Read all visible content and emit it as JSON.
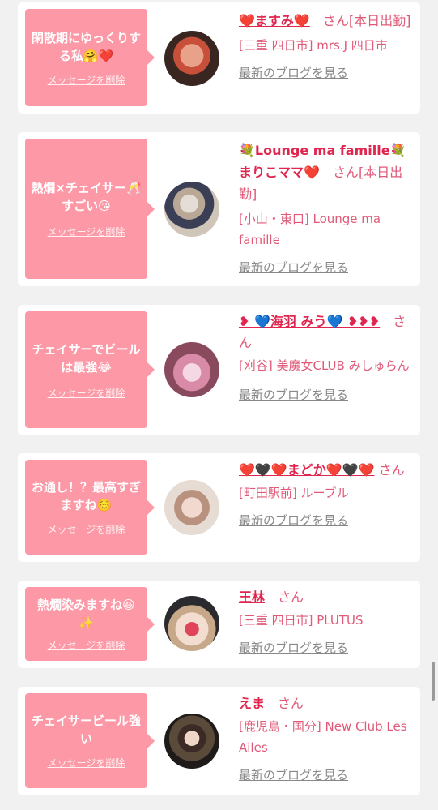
{
  "delete_label": "メッセージを削除",
  "blog_label": "最新のブログを見る",
  "san_label": "さん",
  "cards": [
    {
      "message": "閑散期にゆっくりする私🤗❤️",
      "name_line": "❤️ますみ❤️",
      "after_name": "さん[本日出勤]",
      "shop": "[三重 四日市] mrs.J 四日市"
    },
    {
      "message": "熱燗×チェイサー🥂すごい😘",
      "name_line": "💐Lounge ma famille💐 まりこママ❤️",
      "after_name": "さん[本日出勤]",
      "shop": "[小山・東口] Lounge ma famille"
    },
    {
      "message": "チェイサーでビールは最強😂",
      "name_line": "❥ 💙海羽 みう💙 ❥❥❥",
      "after_name": "さん",
      "shop": "[刈谷] 美魔女CLUB みしゅらん"
    },
    {
      "message": "お通し！？最高すぎますね☺️",
      "name_line": "❤️🖤❤️まどか❤️🖤❤️",
      "after_name": "さん",
      "shop": "[町田駅前] ルーブル"
    },
    {
      "message": "熱燗染みますね😆✨",
      "name_line": "王林",
      "after_name": "さん",
      "shop": "[三重 四日市] PLUTUS"
    },
    {
      "message": "チェイサービール強い",
      "name_line": "えま",
      "after_name": "さん",
      "shop": "[鹿児島・国分] New Club Les Ailes"
    }
  ]
}
